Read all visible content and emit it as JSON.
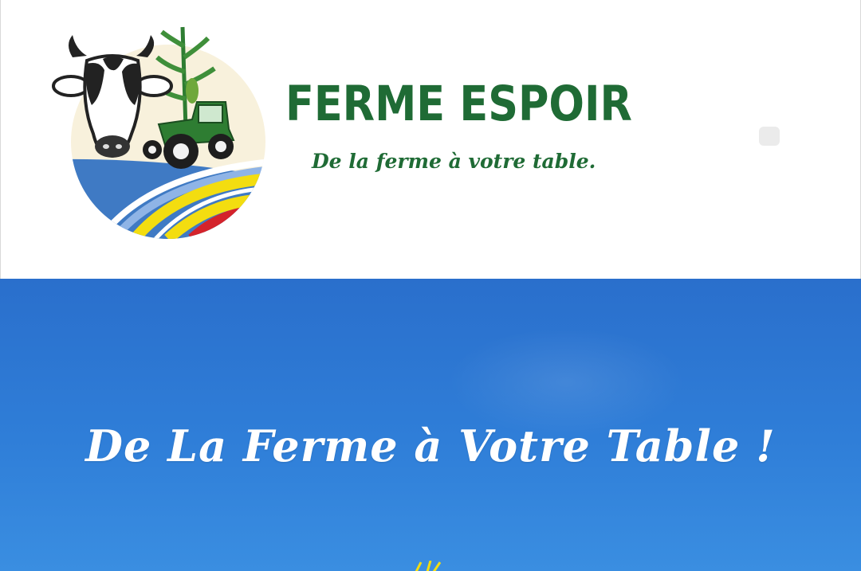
{
  "header": {
    "brand_name": "FERME ESPOIR",
    "tagline": "De la ferme à votre table.",
    "logo_icon": "farm-logo-icon",
    "menu_icon": "menu-icon"
  },
  "hero": {
    "title": "De La Ferme à Votre Table !"
  },
  "colors": {
    "brand_green": "#1f6b35",
    "hero_blue": "#2f7ed8",
    "stripe_blue": "#3f7ac4",
    "stripe_yellow": "#f3dd10",
    "stripe_red": "#d4232b"
  }
}
